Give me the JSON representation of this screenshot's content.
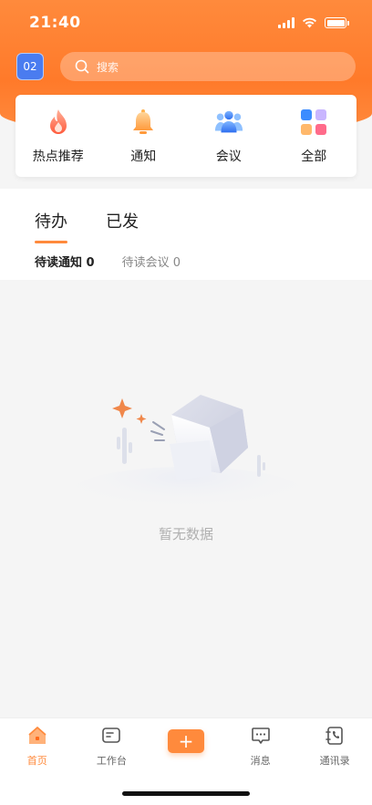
{
  "status_bar": {
    "time": "21:40"
  },
  "header": {
    "avatar_text": "02",
    "search_placeholder": "搜索"
  },
  "quick_entries": [
    {
      "label": "热点推荐",
      "icon": "flame-icon"
    },
    {
      "label": "通知",
      "icon": "bell-icon"
    },
    {
      "label": "会议",
      "icon": "meeting-icon"
    },
    {
      "label": "全部",
      "icon": "apps-grid-icon"
    }
  ],
  "todo": {
    "tabs": [
      {
        "label": "待办",
        "active": true
      },
      {
        "label": "已发",
        "active": false
      }
    ],
    "subtabs": [
      {
        "label": "待读通知 0",
        "active": true
      },
      {
        "label": "待读会议 0",
        "active": false
      }
    ]
  },
  "empty_state": {
    "text": "暂无数据"
  },
  "bottom_nav": [
    {
      "label": "首页",
      "icon": "home-icon",
      "active": true
    },
    {
      "label": "工作台",
      "icon": "workbench-icon",
      "active": false
    },
    {
      "label": "",
      "icon": "plus-icon",
      "active": false
    },
    {
      "label": "消息",
      "icon": "message-icon",
      "active": false
    },
    {
      "label": "通讯录",
      "icon": "contacts-icon",
      "active": false
    }
  ],
  "colors": {
    "brand_orange": "#ff8a3c",
    "avatar_blue": "#4a7cf0"
  }
}
